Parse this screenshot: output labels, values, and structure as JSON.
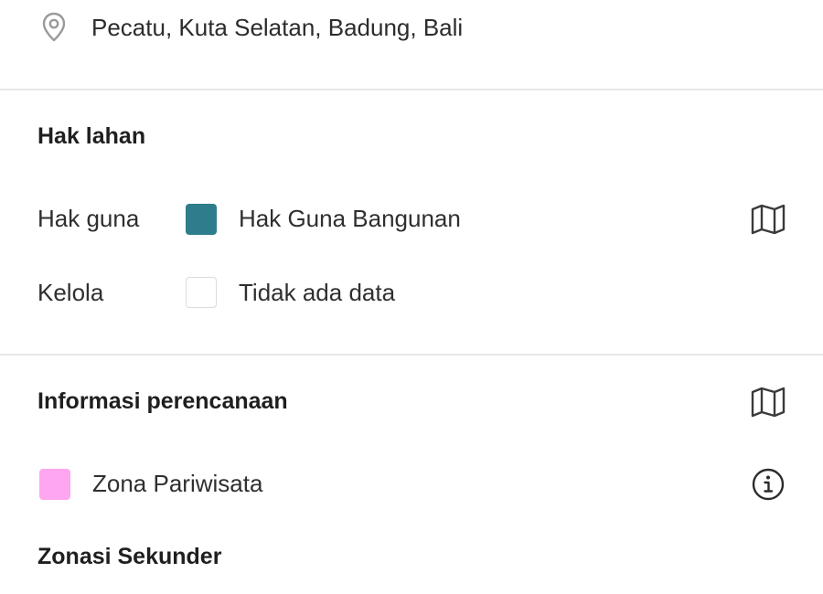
{
  "location": {
    "icon": "map-pin-icon",
    "text": "Pecatu, Kuta Selatan, Badung, Bali"
  },
  "hak_lahan": {
    "title": "Hak lahan",
    "rows": [
      {
        "label": "Hak guna",
        "swatch_color": "#2e7d8c",
        "value": "Hak Guna Bangunan",
        "action_icon": "map-icon"
      },
      {
        "label": "Kelola",
        "swatch_color": "#ffffff",
        "value": "Tidak ada data"
      }
    ]
  },
  "informasi_perencanaan": {
    "title": "Informasi perencanaan",
    "action_icon": "map-icon",
    "zone": {
      "swatch_color": "#ffa6f0",
      "label": "Zona Pariwisata",
      "action_icon": "info-icon"
    }
  },
  "zonasi_sekunder": {
    "title": "Zonasi Sekunder"
  },
  "colors": {
    "divider": "#e7e7e7",
    "text": "#2f2f2f",
    "icon": "#3a3a3a"
  }
}
